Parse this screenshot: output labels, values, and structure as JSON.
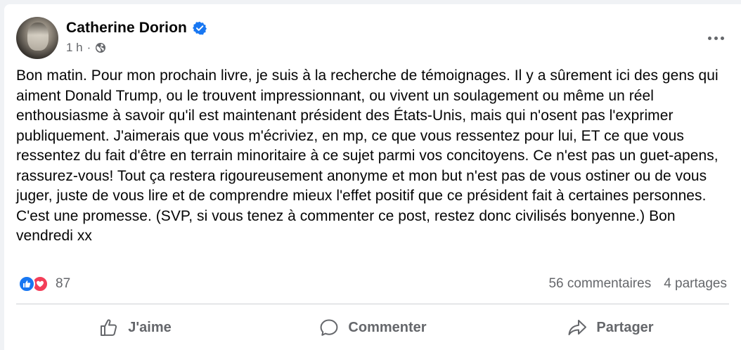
{
  "post": {
    "author": "Catherine Dorion",
    "time": "1 h",
    "separator": "·",
    "paragraphs": [
      "Bon matin. Pour mon prochain livre, je suis à la recherche de témoignages. Il y a sûrement ici des gens qui aiment Donald Trump, ou le trouvent impressionnant, ou vivent un soulagement ou même un réel enthousiasme à savoir qu'il est maintenant président des États-Unis, mais qui n'osent pas l'exprimer publiquement. J'aimerais que vous m'écriviez, en mp, ce que vous ressentez pour lui, ET ce que vous ressentez du fait d'être en terrain minoritaire à ce sujet parmi vos concitoyens. Ce n'est pas un guet-apens, rassurez-vous! Tout ça restera rigoureusement anonyme et mon but n'est pas de vous ostiner ou de vous juger, juste de vous lire et de comprendre mieux l'effet positif que ce président fait à certaines personnes. C'est une promesse. (SVP, si vous tenez à commenter ce post, restez donc civilisés bonyenne.) Bon vendredi xx"
    ]
  },
  "stats": {
    "reactions_count": "87",
    "comments": "56 commentaires",
    "shares": "4 partages"
  },
  "actions": {
    "like": "J'aime",
    "comment": "Commenter",
    "share": "Partager"
  },
  "colors": {
    "verified": "#1877f2",
    "like_reaction": "#1877f2",
    "love_reaction": "#f33e58",
    "secondary_text": "#65676b"
  },
  "icons": [
    "verified-badge-icon",
    "globe-icon",
    "more-options-icon",
    "like-reaction-icon",
    "love-reaction-icon",
    "thumbs-up-icon",
    "comment-bubble-icon",
    "share-arrow-icon"
  ]
}
